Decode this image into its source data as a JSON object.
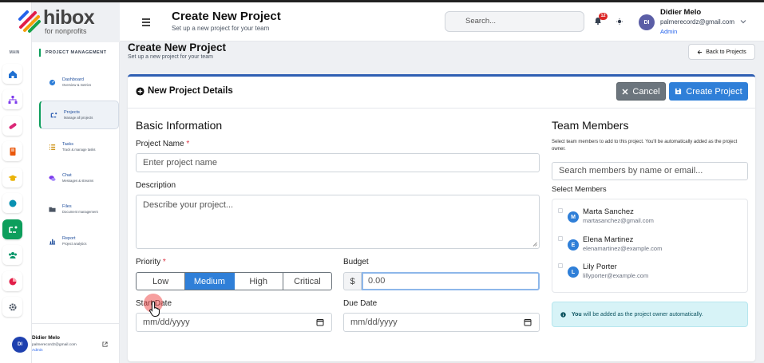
{
  "brand": {
    "name": "hibox",
    "tagline": "for nonprofits"
  },
  "rail": {
    "section_label": "MAIN"
  },
  "nav": {
    "section_title": "PROJECT MANAGEMENT",
    "items": [
      {
        "label": "Dashboard",
        "sub": "Overview & metrics"
      },
      {
        "label": "Projects",
        "sub": "Manage all projects"
      },
      {
        "label": "Tasks",
        "sub": "Track & manage tasks"
      },
      {
        "label": "Chat",
        "sub": "Messages & streams"
      },
      {
        "label": "Files",
        "sub": "Document management"
      },
      {
        "label": "Report",
        "sub": "Project analytics"
      }
    ],
    "user": {
      "initials": "DI",
      "name": "Didier Melo",
      "email": "palmerecordz@gmail.com",
      "role": "Admin"
    }
  },
  "header": {
    "title": "Create New Project",
    "subtitle": "Set up a new project for your team",
    "search_placeholder": "Search...",
    "notif_count": "12",
    "user": {
      "initials": "DI",
      "name": "Didier Melo",
      "email": "palmerecordz@gmail.com",
      "role": "Admin"
    }
  },
  "page": {
    "title": "Create New Project",
    "subtitle": "Set up a new project for your team",
    "back_label": "Back to Projects"
  },
  "form": {
    "header_title": "New Project Details",
    "cancel_label": "Cancel",
    "create_label": "Create Project",
    "basic_title": "Basic Information",
    "name_label": "Project Name",
    "name_placeholder": "Enter project name",
    "desc_label": "Description",
    "desc_placeholder": "Describe your project...",
    "priority_label": "Priority",
    "priority_options": [
      "Low",
      "Medium",
      "High",
      "Critical"
    ],
    "priority_selected": "Medium",
    "budget_label": "Budget",
    "currency": "$",
    "budget_placeholder": "0.00",
    "start_label": "Start Date",
    "due_label": "Due Date",
    "date_placeholder": "mm/dd/yyyy",
    "required_mark": "*"
  },
  "team": {
    "title": "Team Members",
    "help": "Select team members to add to this project. You'll be automatically added as the project owner.",
    "search_placeholder": "Search members by name or email...",
    "select_label": "Select Members",
    "members": [
      {
        "initial": "M",
        "name": "Marta Sanchez",
        "email": "martasanchez@gmail.com"
      },
      {
        "initial": "E",
        "name": "Elena Martinez",
        "email": "elenamartinez@example.com"
      },
      {
        "initial": "L",
        "name": "Lily Porter",
        "email": "lillyporter@example.com"
      }
    ],
    "info_bold": "You",
    "info_rest": " will be added as the project owner automatically."
  },
  "colors": {
    "accent": "#2f7fd8",
    "brand_green": "#0d9e5c",
    "header_rule": "#2f5fb3"
  }
}
